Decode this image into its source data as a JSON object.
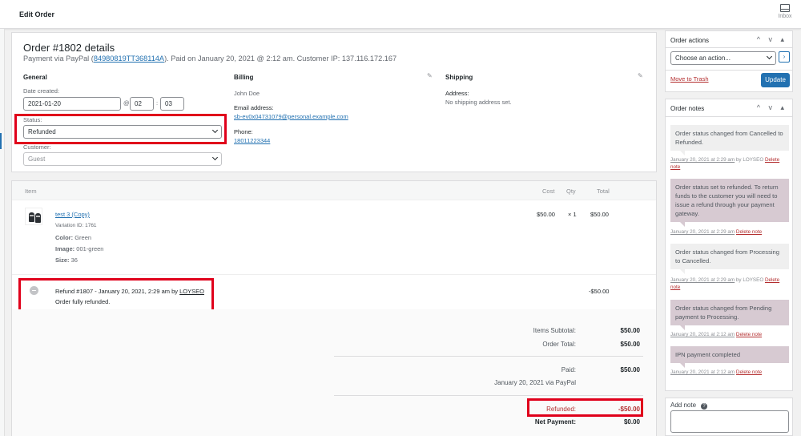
{
  "header": {
    "title": "Edit Order",
    "inbox_label": "Inbox"
  },
  "order": {
    "heading": "Order #1802 details",
    "payment_prefix": "Payment via PayPal (",
    "transaction_id": "84980819TT368114A",
    "payment_suffix": "). Paid on January 20, 2021 @ 2:12 am. Customer IP: 137.116.172.167"
  },
  "general": {
    "heading": "General",
    "date_label": "Date created:",
    "date_value": "2021-01-20",
    "at": "@",
    "hour": "02",
    "minute": "03",
    "colon": ":",
    "status_label": "Status:",
    "status_value": "Refunded",
    "customer_label": "Customer:",
    "customer_value": "Guest"
  },
  "billing": {
    "heading": "Billing",
    "name": "John Doe",
    "email_label": "Email address:",
    "email": "sb-ev0x04731079@personal.example.com",
    "phone_label": "Phone:",
    "phone": "18011223344"
  },
  "shipping": {
    "heading": "Shipping",
    "address_label": "Address:",
    "address_value": "No shipping address set."
  },
  "items": {
    "columns": {
      "item": "Item",
      "cost": "Cost",
      "qty": "Qty",
      "total": "Total"
    },
    "rows": [
      {
        "name": "test 3 (Copy)",
        "variation": "Variation ID: 1761",
        "meta": [
          {
            "k": "Color:",
            "v": "Green"
          },
          {
            "k": "Image:",
            "v": "001-green"
          },
          {
            "k": "Size:",
            "v": "36"
          }
        ],
        "cost": "$50.00",
        "qty": "× 1",
        "total": "$50.00"
      }
    ],
    "refund": {
      "prefix": "Refund #1807 - January 20, 2021, 2:29 am by ",
      "by": "LOYSEO",
      "reason": "Order fully refunded.",
      "amount": "-$50.00"
    }
  },
  "totals": {
    "items_subtotal_label": "Items Subtotal:",
    "items_subtotal": "$50.00",
    "order_total_label": "Order Total:",
    "order_total": "$50.00",
    "paid_label": "Paid:",
    "paid": "$50.00",
    "paid_note": "January 20, 2021 via PayPal",
    "refunded_label": "Refunded:",
    "refunded": "-$50.00",
    "net_label": "Net Payment:",
    "net": "$0.00"
  },
  "order_actions": {
    "title": "Order actions",
    "select_placeholder": "Choose an action...",
    "go": "›",
    "trash": "Move to Trash",
    "update": "Update",
    "arrows": "^ v ▴"
  },
  "order_notes": {
    "title": "Order notes",
    "arrows": "^ v ▴",
    "notes": [
      {
        "text": "Order status changed from Cancelled to Refunded.",
        "date": "January 20, 2021 at 2:29 am",
        "by": " by LOYSEO ",
        "delete": "Delete note"
      },
      {
        "text": "Order status set to refunded. To return funds to the customer you will need to issue a refund through your payment gateway.",
        "date": "January 20, 2021 at 2:29 am",
        "by": " ",
        "delete": "Delete note"
      },
      {
        "text": "Order status changed from Processing to Cancelled.",
        "date": "January 20, 2021 at 2:29 am",
        "by": " by LOYSEO ",
        "delete": "Delete note"
      },
      {
        "text": "Order status changed from Pending payment to Processing.",
        "date": "January 20, 2021 at 2:12 am",
        "by": " ",
        "delete": "Delete note"
      },
      {
        "text": "IPN payment completed",
        "date": "January 20, 2021 at 2:12 am",
        "by": " ",
        "delete": "Delete note"
      }
    ]
  },
  "add_note": {
    "label": "Add note",
    "help": "?"
  },
  "colors": {
    "accent": "#2271b1",
    "highlight": "#e0001b",
    "customer_note": "#d7cad2",
    "system_note": "#efefef"
  }
}
